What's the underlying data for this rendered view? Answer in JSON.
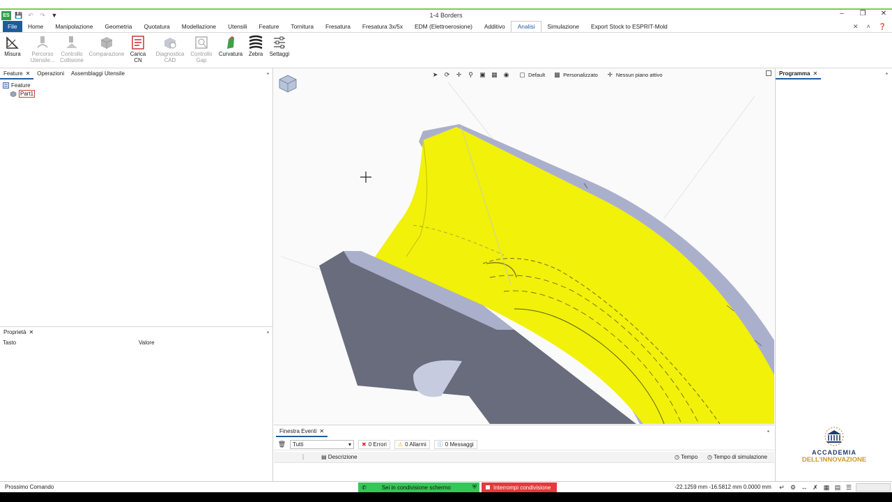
{
  "window": {
    "title": "1-4 Borders",
    "app_badge": "ES"
  },
  "menu": {
    "file": "File",
    "items": [
      "Home",
      "Manipolazione",
      "Geometria",
      "Quotatura",
      "Modellazione",
      "Utensili",
      "Feature",
      "Tornitura",
      "Fresatura",
      "Fresatura 3x/5x",
      "EDM (Elettroerosione)",
      "Additivo",
      "Analisi",
      "Simulazione",
      "Export Stock to ESPRIT-Mold"
    ],
    "active": "Analisi"
  },
  "ribbon": {
    "misura": "Misura",
    "percorso_1": "Percorso",
    "percorso_2": "Utensile...",
    "controllo_1": "Controllo",
    "controllo_2": "Collisione",
    "comparazione": "Comparazione",
    "carica_1": "Carica",
    "carica_2": "CN",
    "diagnostica_1": "Diagnostica",
    "diagnostica_2": "CAD",
    "gap_1": "Controllo",
    "gap_2": "Gap",
    "curvatura": "Curvatura",
    "zebra": "Zebra",
    "settaggi": "Settaggi"
  },
  "left_tabs": [
    "Feature",
    "Operazioni",
    "Assemblaggi Utensile"
  ],
  "tree": {
    "root": "Feature",
    "child": "Part1"
  },
  "properties": {
    "tab": "Proprietà",
    "col_key": "Tasto",
    "col_value": "Valore"
  },
  "viewport": {
    "view_default": "Default",
    "view_custom": "Personalizzato",
    "plane": "Nessun piano attivo"
  },
  "events": {
    "tab": "Finestra Eventi",
    "filter": "Tutti",
    "errors": "0 Errori",
    "alarms": "0 Allarmi",
    "messages": "0 Messaggi",
    "col_desc": "Descrizione",
    "col_time": "Tempo",
    "col_simtime": "Tempo di simulazione"
  },
  "right_panel": {
    "tab": "Programma"
  },
  "logo": {
    "line1": "ACCADEMIA",
    "line2": "DELL'INNOVAZIONE"
  },
  "status": {
    "prompt": "Prossimo Comando",
    "share_status": "Sei in condivisione schermo",
    "share_stop": "Interrompi condivisione",
    "coords": "-22.1259 mm  -16.5812 mm  0.0000 mm"
  },
  "colors": {
    "part_face": "#f1f10a",
    "part_rim": "#aab0cc",
    "accent": "#1e5b9e"
  }
}
